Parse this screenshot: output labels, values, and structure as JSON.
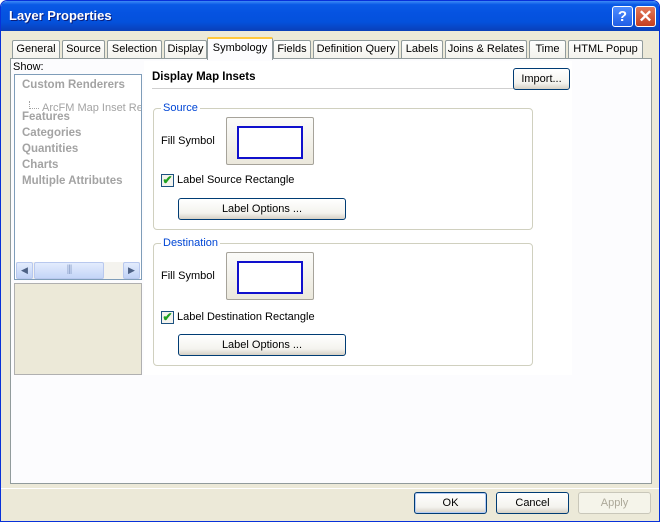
{
  "window": {
    "title": "Layer Properties"
  },
  "tabs": [
    "General",
    "Source",
    "Selection",
    "Display",
    "Symbology",
    "Fields",
    "Definition Query",
    "Labels",
    "Joins & Relates",
    "Time",
    "HTML Popup"
  ],
  "left": {
    "show_label": "Show:",
    "tree": {
      "items": [
        "Custom Renderers",
        "Features",
        "Categories",
        "Quantities",
        "Charts",
        "Multiple Attributes"
      ],
      "sub_item": "ArcFM Map Inset Ren"
    }
  },
  "main": {
    "heading": "Display Map Insets",
    "import_label": "Import...",
    "source": {
      "title": "Source",
      "fill_label": "Fill Symbol",
      "check_label": "Label Source Rectangle",
      "checked": true,
      "button": "Label Options ..."
    },
    "destination": {
      "title": "Destination",
      "fill_label": "Fill Symbol",
      "check_label": "Label Destination Rectangle",
      "checked": true,
      "button": "Label Options ..."
    },
    "swatch_color": "#1010cc"
  },
  "footer": {
    "ok": "OK",
    "cancel": "Cancel",
    "apply": "Apply"
  },
  "icons": {
    "help": "?",
    "close": "✕",
    "check": "✔",
    "scroll_left": "◀",
    "scroll_right": "▶",
    "scroll_grip": "|||"
  }
}
